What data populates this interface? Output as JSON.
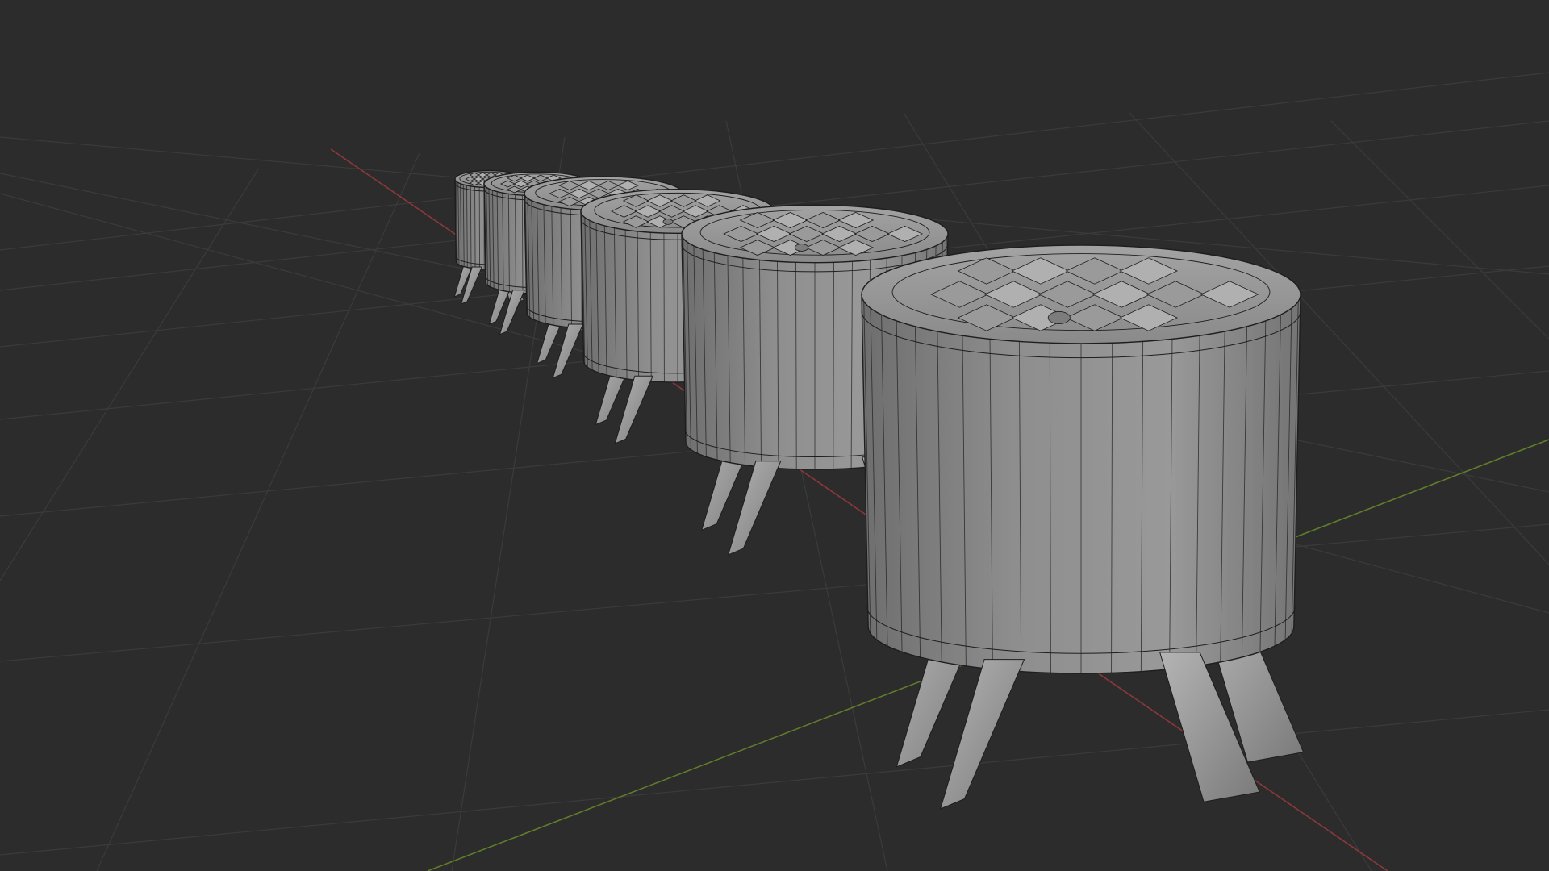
{
  "viewport": {
    "shading": "solid",
    "overlay": "wireframe",
    "background_color": "#2c2c2c",
    "grid_color": "#3a3a3a",
    "x_axis_color": "#9b3b3b",
    "y_axis_color": "#6b8a2f",
    "mesh_face_color": "#8c8c8c",
    "mesh_wire_color": "#1e1e1e"
  },
  "scene": {
    "object_type": "pouf-ottoman",
    "object_count": 6,
    "legs_per_object": 4
  }
}
